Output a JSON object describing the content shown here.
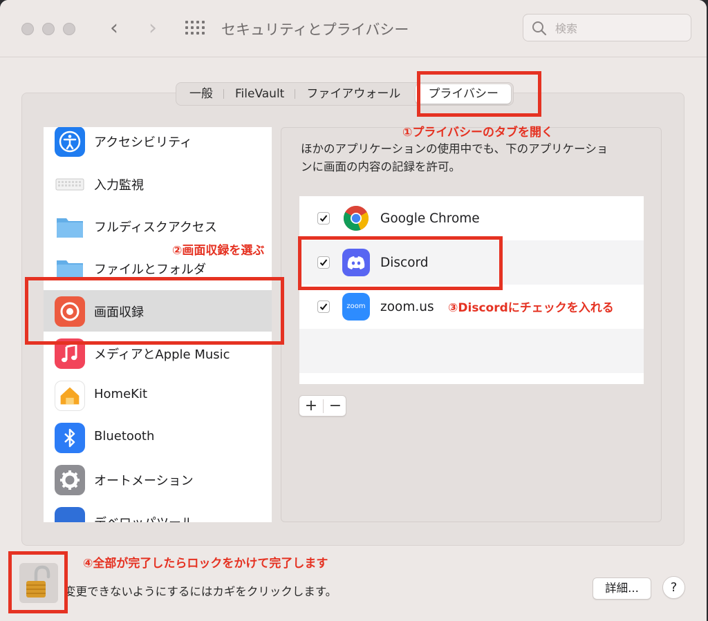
{
  "window": {
    "title": "セキュリティとプライバシー",
    "search_placeholder": "検索",
    "back_glyph": "‹",
    "forward_glyph": "›"
  },
  "tabs": [
    {
      "label": "一般",
      "active": false
    },
    {
      "label": "FileVault",
      "active": false
    },
    {
      "label": "ファイアウォール",
      "active": false
    },
    {
      "label": "プライバシー",
      "active": true
    }
  ],
  "sidebar": {
    "items": [
      {
        "label": "アクセシビリティ",
        "icon": "accessibility-icon",
        "selected": false
      },
      {
        "label": "入力監視",
        "icon": "keyboard-icon",
        "selected": false
      },
      {
        "label": "フルディスクアクセス",
        "icon": "folder-icon",
        "selected": false
      },
      {
        "label": "ファイルとフォルダ",
        "icon": "folder-icon",
        "selected": false
      },
      {
        "label": "画面収録",
        "icon": "screen-recording-icon",
        "selected": true
      },
      {
        "label": "メディアとApple Music",
        "icon": "music-icon",
        "selected": false
      },
      {
        "label": "HomeKit",
        "icon": "home-icon",
        "selected": false
      },
      {
        "label": "Bluetooth",
        "icon": "bluetooth-icon",
        "selected": false
      },
      {
        "label": "オートメーション",
        "icon": "gear-icon",
        "selected": false
      },
      {
        "label": "デベロッパツール",
        "icon": "xcode-icon",
        "selected": false
      }
    ]
  },
  "main": {
    "description_line1": "ほかのアプリケーションの使用中でも、下のアプリケーショ",
    "description_line2": "ンに画面の内容の記録を許可。",
    "apps": [
      {
        "name": "Google Chrome",
        "checked": true,
        "icon": "chrome-icon"
      },
      {
        "name": "Discord",
        "checked": true,
        "icon": "discord-icon"
      },
      {
        "name": "zoom.us",
        "checked": true,
        "icon": "zoom-icon",
        "icon_text": "zoom"
      }
    ],
    "add_label": "+",
    "remove_label": "−"
  },
  "footer": {
    "lock_text": "変更できないようにするにはカギをクリックします。",
    "details_label": "詳細...",
    "help_label": "?"
  },
  "annotations": {
    "step1": "①プライバシーのタブを開く",
    "step2": "②画面収録を選ぶ",
    "step3": "③Discordにチェックを入れる",
    "step4": "④全部が完了したらロックをかけて完了します"
  },
  "colors": {
    "annotation_red": "#e53222",
    "window_bg": "#ede8e6",
    "discord_blurple": "#5865f2",
    "zoom_blue": "#2d8cff"
  }
}
